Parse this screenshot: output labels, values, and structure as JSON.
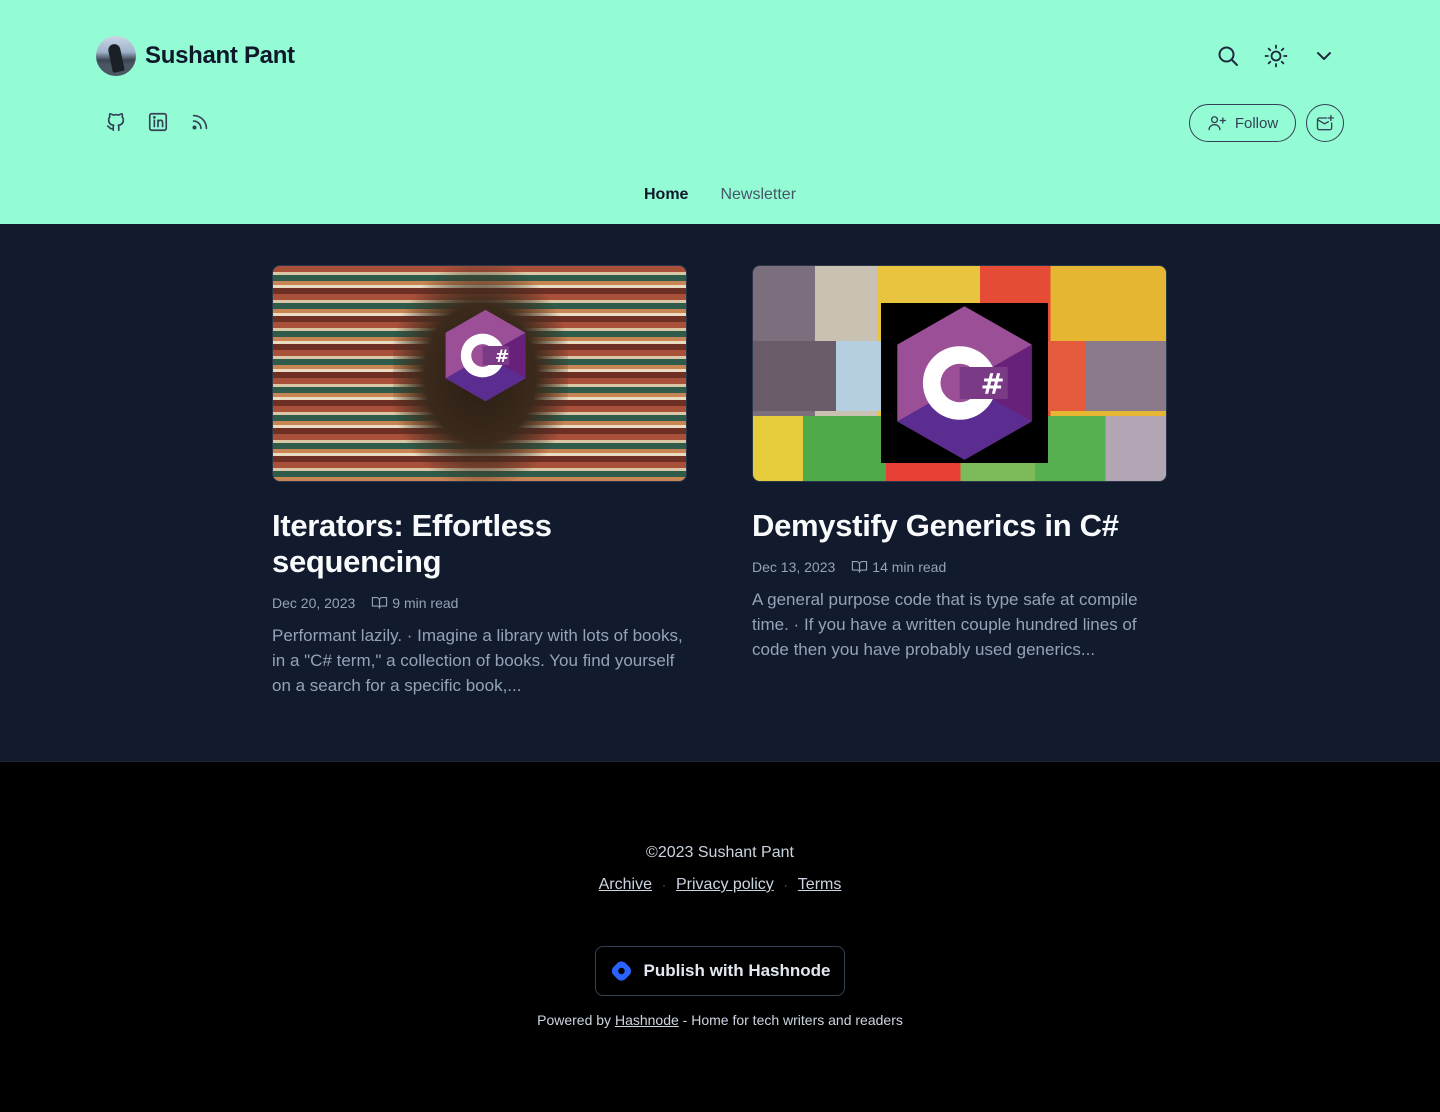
{
  "header": {
    "blog_name": "Sushant Pant",
    "top_icons": [
      "search-icon",
      "sun-icon",
      "chevron-down-icon"
    ],
    "social_icons": [
      "github-icon",
      "linkedin-icon",
      "rss-icon"
    ],
    "follow_label": "Follow",
    "colors": {
      "background": "#94fcd5",
      "text": "#0f172a"
    }
  },
  "nav": {
    "items": [
      {
        "label": "Home",
        "active": true
      },
      {
        "label": "Newsletter",
        "active": false
      }
    ]
  },
  "posts": [
    {
      "title": "Iterators: Effortless sequencing",
      "date": "Dec 20, 2023",
      "read_time": "9 min read",
      "brief": "Performant lazily. · Imagine a library with lots of books, in a \"C# term,\" a collection of books. You find yourself on a search for a specific book,..."
    },
    {
      "title": "Demystify Generics in C#",
      "date": "Dec 13, 2023",
      "read_time": "14 min read",
      "brief": "A general purpose code that is type safe at compile time. · If you have a written couple hundred lines of code then you have probably used generics..."
    }
  ],
  "footer": {
    "copyright": "©2023 Sushant Pant",
    "links": [
      "Archive",
      "Privacy policy",
      "Terms"
    ],
    "publish_label": "Publish with Hashnode",
    "powered_prefix": "Powered by",
    "powered_link": "Hashnode",
    "powered_suffix": "- Home for tech writers and readers"
  },
  "colors": {
    "main_bg": "#121a2d",
    "footer_bg": "#000000",
    "hashnode_blue": "#2962ff",
    "csharp_purple": "#9b4f96"
  }
}
